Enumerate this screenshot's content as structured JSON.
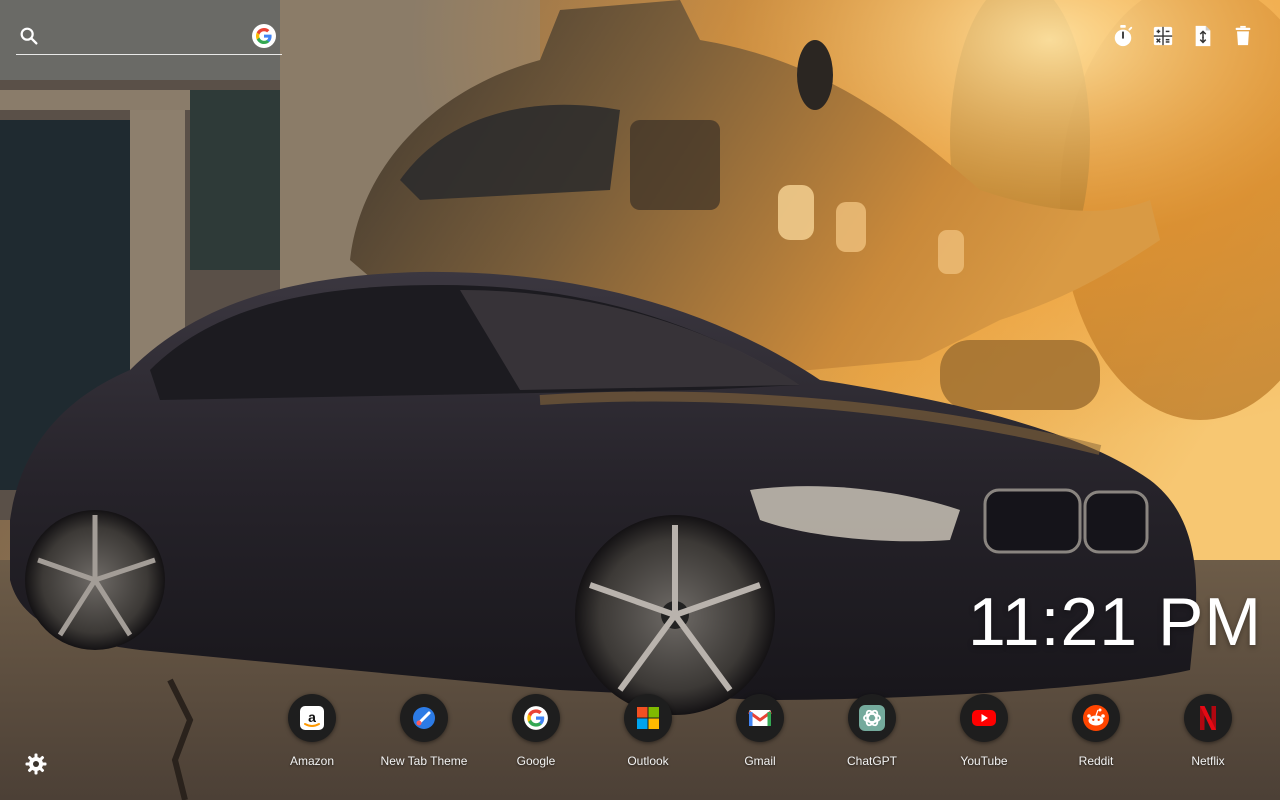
{
  "search": {
    "placeholder": "",
    "engine_icon": "google-icon"
  },
  "toolbar": {
    "items": [
      {
        "icon": "timer-icon"
      },
      {
        "icon": "calculator-icon"
      },
      {
        "icon": "file-transfer-icon"
      },
      {
        "icon": "trash-icon"
      }
    ]
  },
  "clock": {
    "time": "11:21 PM"
  },
  "shortcuts": [
    {
      "label": "Amazon",
      "icon": "amazon-icon"
    },
    {
      "label": "New Tab Theme",
      "icon": "new-tab-theme-icon"
    },
    {
      "label": "Google",
      "icon": "google-icon"
    },
    {
      "label": "Outlook",
      "icon": "outlook-icon"
    },
    {
      "label": "Gmail",
      "icon": "gmail-icon"
    },
    {
      "label": "ChatGPT",
      "icon": "chatgpt-icon"
    },
    {
      "label": "YouTube",
      "icon": "youtube-icon"
    },
    {
      "label": "Reddit",
      "icon": "reddit-icon"
    },
    {
      "label": "Netflix",
      "icon": "netflix-icon"
    }
  ],
  "settings": {
    "icon": "gear-icon"
  },
  "colors": {
    "clock_text": "#ffffff",
    "tile_background": "#1e1e1e",
    "sunset_glow": "#f2a23a",
    "car_body": "#2b2830"
  }
}
